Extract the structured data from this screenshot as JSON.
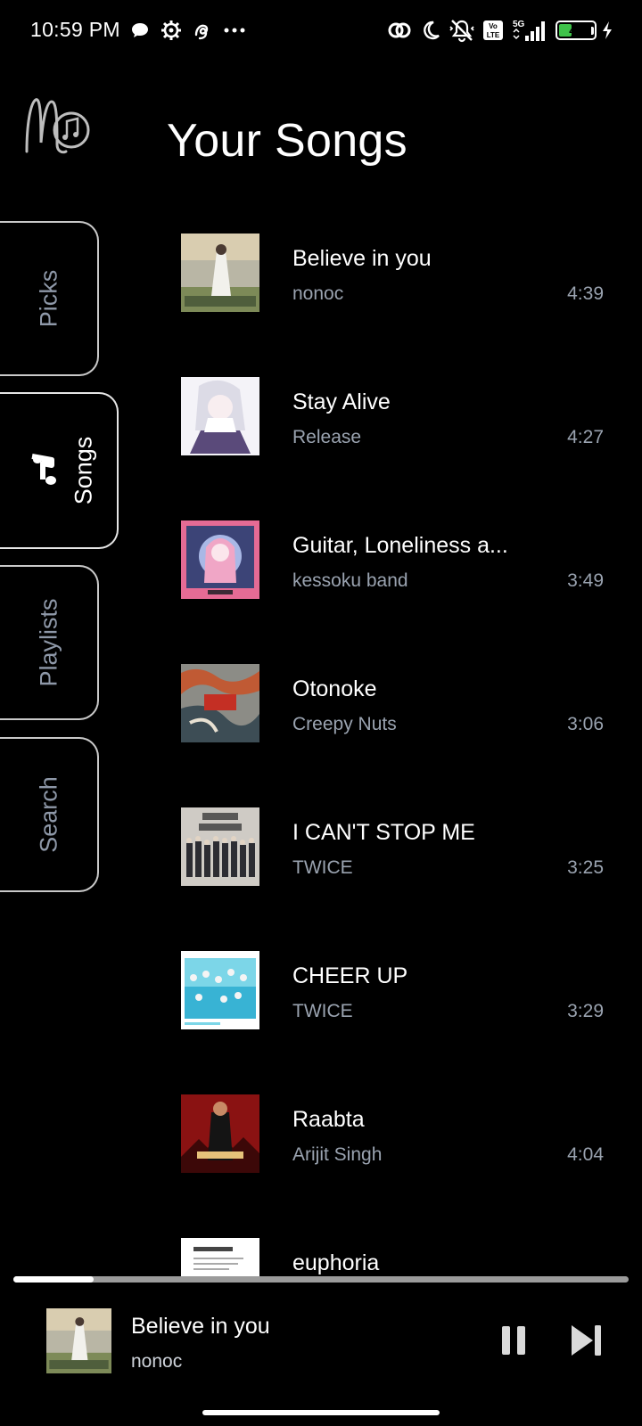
{
  "status_bar": {
    "time": "10:59 PM",
    "left_icons": [
      "chat-bubble-icon",
      "settings-gear-icon",
      "app-spiral-icon",
      "more-dots-icon"
    ],
    "right_icons": [
      "link-icon",
      "moon-icon",
      "vibrate-off-icon",
      "volte-icon",
      "signal-5g-icon"
    ],
    "network_label": "5G",
    "volte_label": "Vo LTE",
    "battery_level": "43",
    "battery_fraction": 0.43,
    "charging": true
  },
  "app": {
    "logo_icon": "music-logo-icon",
    "title": "Your Songs"
  },
  "nav": {
    "tabs": [
      {
        "label": "Picks",
        "active": false
      },
      {
        "label": "Songs",
        "active": true,
        "icon": "music-note-icon"
      },
      {
        "label": "Playlists",
        "active": false
      },
      {
        "label": "Search",
        "active": false
      }
    ]
  },
  "songs": [
    {
      "title": "Believe in you",
      "artist": "nonoc",
      "duration": "4:39"
    },
    {
      "title": "Stay Alive",
      "artist": "Release",
      "duration": "4:27"
    },
    {
      "title": "Guitar, Loneliness a...",
      "artist": "kessoku band",
      "duration": "3:49"
    },
    {
      "title": "Otonoke",
      "artist": "Creepy Nuts",
      "duration": "3:06"
    },
    {
      "title": "I CAN'T STOP ME",
      "artist": "TWICE",
      "duration": "3:25"
    },
    {
      "title": "CHEER UP",
      "artist": "TWICE",
      "duration": "3:29"
    },
    {
      "title": "Raabta",
      "artist": "Arijit Singh",
      "duration": "4:04"
    },
    {
      "title": "euphoria",
      "artist": "",
      "duration": ""
    }
  ],
  "player": {
    "progress_fraction": 0.13,
    "now_playing": {
      "title": "Believe in you",
      "artist": "nonoc"
    },
    "controls": [
      "pause-icon",
      "skip-next-icon"
    ]
  },
  "colors": {
    "background": "#000000",
    "text_primary": "#ffffff",
    "text_secondary": "#9aa3b0",
    "tab_inactive_text": "#8e98a8",
    "battery_fill": "#3fc24a"
  }
}
